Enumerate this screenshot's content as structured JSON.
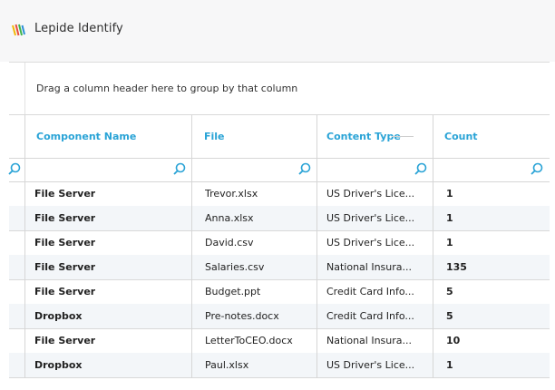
{
  "app": {
    "title": "Lepide Identify"
  },
  "grid": {
    "group_hint": "Drag a column header here to group by that column",
    "columns": [
      {
        "label": "Component Name"
      },
      {
        "label": "File"
      },
      {
        "label": "Content Type"
      },
      {
        "label": "Count"
      }
    ],
    "rows": [
      {
        "component": "File Server",
        "file": "Trevor.xlsx",
        "content_type": "US Driver's Lice...",
        "count": "1"
      },
      {
        "component": "File Server",
        "file": "Anna.xlsx",
        "content_type": "US Driver's Lice...",
        "count": "1"
      },
      {
        "component": "File Server",
        "file": "David.csv",
        "content_type": "US Driver's Lice...",
        "count": "1"
      },
      {
        "component": "File Server",
        "file": "Salaries.csv",
        "content_type": "National Insura...",
        "count": "135"
      },
      {
        "component": "File Server",
        "file": "Budget.ppt",
        "content_type": "Credit Card Info...",
        "count": "5"
      },
      {
        "component": "Dropbox",
        "file": "Pre-notes.docx",
        "content_type": "Credit Card Info...",
        "count": "5"
      },
      {
        "component": "File Server",
        "file": "LetterToCEO.docx",
        "content_type": "National Insura...",
        "count": "10"
      },
      {
        "component": "Dropbox",
        "file": "Paul.xlsx",
        "content_type": "US Driver's Lice...",
        "count": "1"
      }
    ]
  },
  "icons": {
    "logo": "lepide-logo-icon",
    "search": "search-icon"
  },
  "colors": {
    "accent": "#29a3d6",
    "row_alt": "#f3f6f9"
  }
}
